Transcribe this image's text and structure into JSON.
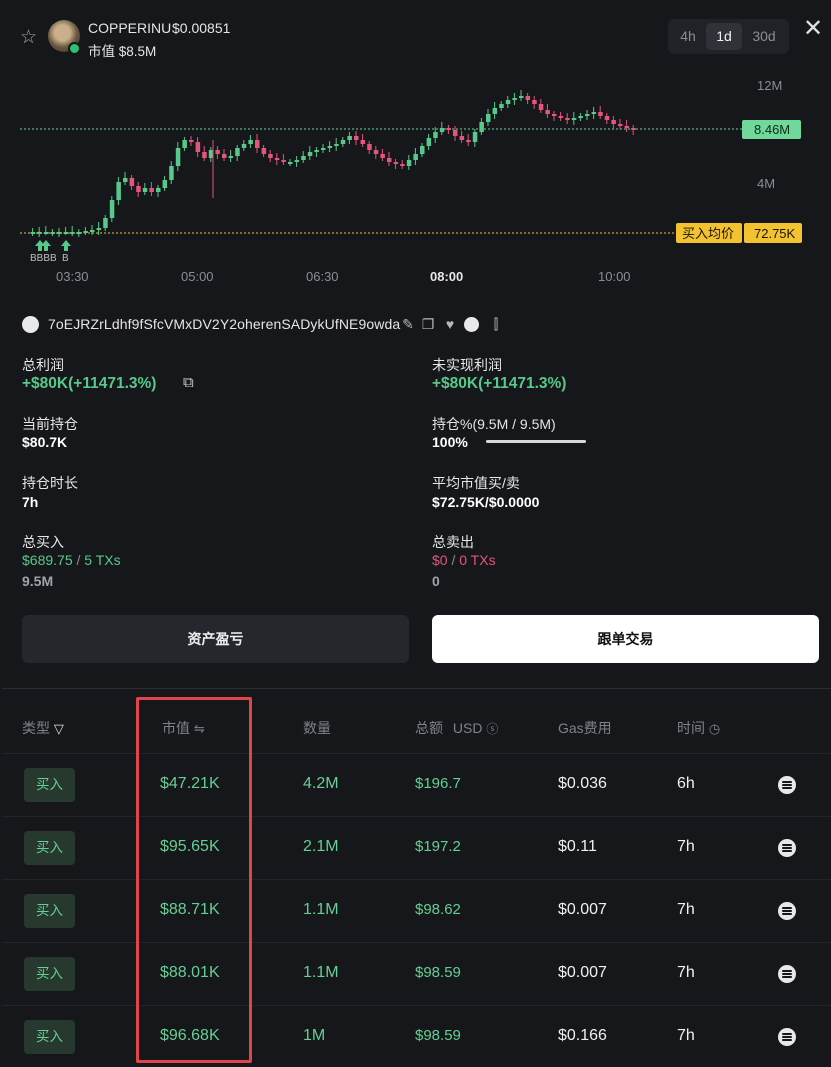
{
  "header": {
    "token_name": "COPPERINU",
    "token_price": "$0.00851",
    "market_cap": "市值 $8.5M",
    "timeframes": [
      "4h",
      "1d",
      "30d"
    ],
    "active_timeframe": "1d"
  },
  "chart": {
    "y_ticks": [
      "12M",
      "4M"
    ],
    "current_label": "8.46M",
    "avg_buy_label": "买入均价",
    "avg_buy_value": "72.75K",
    "x_ticks": [
      "03:30",
      "05:00",
      "06:30",
      "08:00",
      "10:00"
    ],
    "marker_labels": [
      "BBBB",
      "B"
    ],
    "colors": {
      "up": "#58c98b",
      "down": "#e3557b",
      "current": "#6fd89a",
      "avg": "#f2c230"
    }
  },
  "wallet": {
    "address": "7oEJRZrLdhf9fSfcVMxDV2Y2oherenSADykUfNE9owda"
  },
  "stats": {
    "total_profit_label": "总利润",
    "total_profit_value": "+$80K(+11471.3%)",
    "unrealized_label": "未实现利润",
    "unrealized_value": "+$80K(+11471.3%)",
    "holding_label": "当前持仓",
    "holding_value": "$80.7K",
    "holding_pct_label": "持仓%(9.5M / 9.5M)",
    "holding_pct_value": "100%",
    "holding_pct_fraction": 1.0,
    "duration_label": "持仓时长",
    "duration_value": "7h",
    "avg_mcap_label": "平均市值买/卖",
    "avg_mcap_value": "$72.75K/$0.0000",
    "total_buy_label": "总买入",
    "total_buy_usd": "$689.75",
    "total_buy_sep": "/",
    "total_buy_txs": "5 TXs",
    "total_buy_amount": "9.5M",
    "total_sell_label": "总卖出",
    "total_sell_usd": "$0",
    "total_sell_sep": "/",
    "total_sell_txs": "0 TXs",
    "total_sell_amount": "0"
  },
  "buttons": {
    "pnl": "资产盈亏",
    "copy_trade": "跟单交易"
  },
  "table": {
    "headers": {
      "type": "类型",
      "mcap": "市值",
      "amount": "数量",
      "total": "总额",
      "total_unit": "USD",
      "gas": "Gas费用",
      "time": "时间"
    },
    "rows": [
      {
        "type": "买入",
        "mcap": "$47.21K",
        "amount": "4.2M",
        "total": "$196.7",
        "gas": "$0.036",
        "time": "6h"
      },
      {
        "type": "买入",
        "mcap": "$95.65K",
        "amount": "2.1M",
        "total": "$197.2",
        "gas": "$0.11",
        "time": "7h"
      },
      {
        "type": "买入",
        "mcap": "$88.71K",
        "amount": "1.1M",
        "total": "$98.62",
        "gas": "$0.007",
        "time": "7h"
      },
      {
        "type": "买入",
        "mcap": "$88.01K",
        "amount": "1.1M",
        "total": "$98.59",
        "gas": "$0.007",
        "time": "7h"
      },
      {
        "type": "买入",
        "mcap": "$96.68K",
        "amount": "1M",
        "total": "$98.59",
        "gas": "$0.166",
        "time": "7h"
      }
    ]
  }
}
